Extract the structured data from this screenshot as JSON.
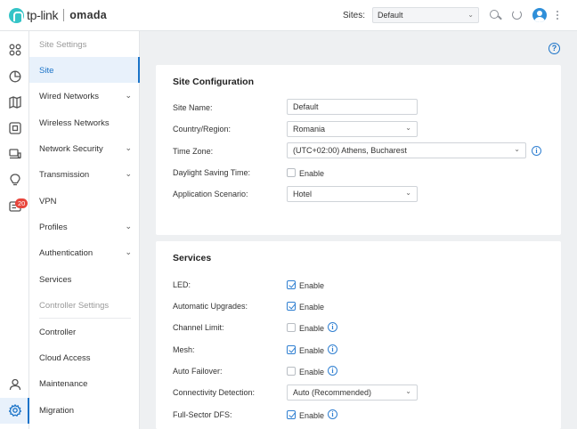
{
  "header": {
    "logo_brand": "tp-link",
    "logo_product": "omada",
    "sites_label": "Sites:",
    "sites_value": "Default",
    "icons": [
      "search-icon",
      "refresh-icon",
      "avatar",
      "more-icon"
    ]
  },
  "rail": {
    "icons": [
      "dashboard-icon",
      "statistics-icon",
      "map-icon",
      "devices-icon",
      "clients-icon",
      "insight-icon",
      "logs-icon",
      "account-icon",
      "settings-icon"
    ],
    "logs_badge": "20"
  },
  "sidebar": {
    "site_settings_header": "Site Settings",
    "items": [
      {
        "label": "Site",
        "active": true,
        "has_chevron": false
      },
      {
        "label": "Wired Networks",
        "has_chevron": true
      },
      {
        "label": "Wireless Networks",
        "has_chevron": false
      },
      {
        "label": "Network Security",
        "has_chevron": true
      },
      {
        "label": "Transmission",
        "has_chevron": true
      },
      {
        "label": "VPN",
        "has_chevron": false
      },
      {
        "label": "Profiles",
        "has_chevron": true
      },
      {
        "label": "Authentication",
        "has_chevron": true
      },
      {
        "label": "Services",
        "has_chevron": false
      }
    ],
    "controller_settings_header": "Controller Settings",
    "controller_items": [
      {
        "label": "Controller"
      },
      {
        "label": "Cloud Access"
      },
      {
        "label": "Maintenance"
      },
      {
        "label": "Migration"
      }
    ]
  },
  "site_configuration": {
    "title": "Site Configuration",
    "site_name_label": "Site Name:",
    "site_name_value": "Default",
    "country_label": "Country/Region:",
    "country_value": "Romania",
    "timezone_label": "Time Zone:",
    "timezone_value": "(UTC+02:00) Athens, Bucharest",
    "dst_label": "Daylight Saving Time:",
    "dst_enable_label": "Enable",
    "dst_checked": false,
    "scenario_label": "Application Scenario:",
    "scenario_value": "Hotel"
  },
  "services": {
    "title": "Services",
    "rows": [
      {
        "label": "LED:",
        "enable_label": "Enable",
        "checked": true,
        "info": false
      },
      {
        "label": "Automatic Upgrades:",
        "enable_label": "Enable",
        "checked": true,
        "info": false
      },
      {
        "label": "Channel Limit:",
        "enable_label": "Enable",
        "checked": false,
        "info": true
      },
      {
        "label": "Mesh:",
        "enable_label": "Enable",
        "checked": true,
        "info": true
      },
      {
        "label": "Auto Failover:",
        "enable_label": "Enable",
        "checked": false,
        "info": true
      }
    ],
    "connectivity_label": "Connectivity Detection:",
    "connectivity_value": "Auto (Recommended)",
    "dfs_label": "Full-Sector DFS:",
    "dfs_enable_label": "Enable",
    "dfs_checked": true
  },
  "colors": {
    "accent": "#1a73c8",
    "logo": "#34c4c7",
    "badge": "#e8453c"
  }
}
